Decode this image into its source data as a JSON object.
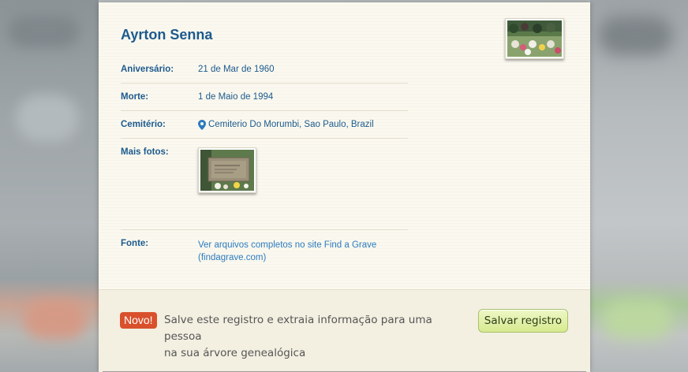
{
  "record": {
    "name": "Ayrton Senna",
    "fields": [
      {
        "label": "Aniversário:",
        "value": "21 de Mar de 1960"
      },
      {
        "label": "Morte:",
        "value": "1 de Maio de 1994"
      },
      {
        "label": "Cemitério:",
        "value": "Cemiterio Do Morumbi, Sao Paulo, Brazil"
      }
    ],
    "more_photos_label": "Mais fotos:",
    "source_label": "Fonte:",
    "source_link_line1": "Ver arquivos completos no site Find a Grave",
    "source_link_line2": "(findagrave.com)"
  },
  "footer": {
    "badge": "Novo!",
    "text_line1": "Salve este registro e extraia informação para uma pessoa",
    "text_line2": "na sua árvore genealógica",
    "save_button": "Salvar registro"
  },
  "icons": {
    "location": "map-pin-icon"
  },
  "colors": {
    "title": "#1d5a8e",
    "link": "#2b7bbf",
    "badge": "#d9512c",
    "button": "#d7ea8f",
    "panel": "#fbf9ef"
  }
}
